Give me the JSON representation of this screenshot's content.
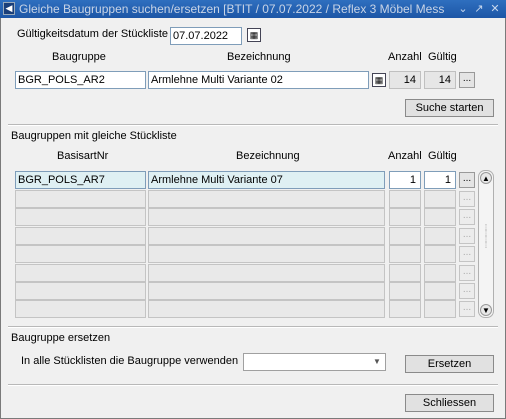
{
  "window": {
    "title": "Gleiche Baugruppen suchen/ersetzen  [BTIT / 07.07.2022 / Reflex 3 Möbel Mess",
    "controls": [
      "⌄",
      "↗",
      "✕"
    ]
  },
  "validity": {
    "label": "Gültigkeitsdatum der Stückliste",
    "date": "07.07.2022"
  },
  "search": {
    "headers": {
      "baugruppe": "Baugruppe",
      "bezeichnung": "Bezeichnung",
      "anzahl": "Anzahl",
      "gueltig": "Gültig"
    },
    "baugruppe": "BGR_POLS_AR2",
    "bezeichnung": "Armlehne Multi Variante 02",
    "anzahl": "14",
    "gueltig": "14",
    "more_label": "...",
    "start_button": "Suche starten"
  },
  "same_list": {
    "section_title": "Baugruppen mit gleiche Stückliste",
    "headers": {
      "basisart": "BasisartNr",
      "bezeichnung": "Bezeichnung",
      "anzahl": "Anzahl",
      "gueltig": "Gültig"
    },
    "rows": [
      {
        "basisart": "BGR_POLS_AR7",
        "bezeichnung": "Armlehne Multi Variante 07",
        "anzahl": "1",
        "gueltig": "1"
      },
      {
        "basisart": "",
        "bezeichnung": "",
        "anzahl": "",
        "gueltig": ""
      },
      {
        "basisart": "",
        "bezeichnung": "",
        "anzahl": "",
        "gueltig": ""
      },
      {
        "basisart": "",
        "bezeichnung": "",
        "anzahl": "",
        "gueltig": ""
      },
      {
        "basisart": "",
        "bezeichnung": "",
        "anzahl": "",
        "gueltig": ""
      },
      {
        "basisart": "",
        "bezeichnung": "",
        "anzahl": "",
        "gueltig": ""
      },
      {
        "basisart": "",
        "bezeichnung": "",
        "anzahl": "",
        "gueltig": ""
      },
      {
        "basisart": "",
        "bezeichnung": "",
        "anzahl": "",
        "gueltig": ""
      }
    ],
    "more_label": "..."
  },
  "replace": {
    "section_title": "Baugruppe ersetzen",
    "use_label": "In alle Stücklisten die Baugruppe verwenden",
    "combo_value": "",
    "replace_button": "Ersetzen"
  },
  "footer": {
    "close_button": "Schliessen"
  }
}
